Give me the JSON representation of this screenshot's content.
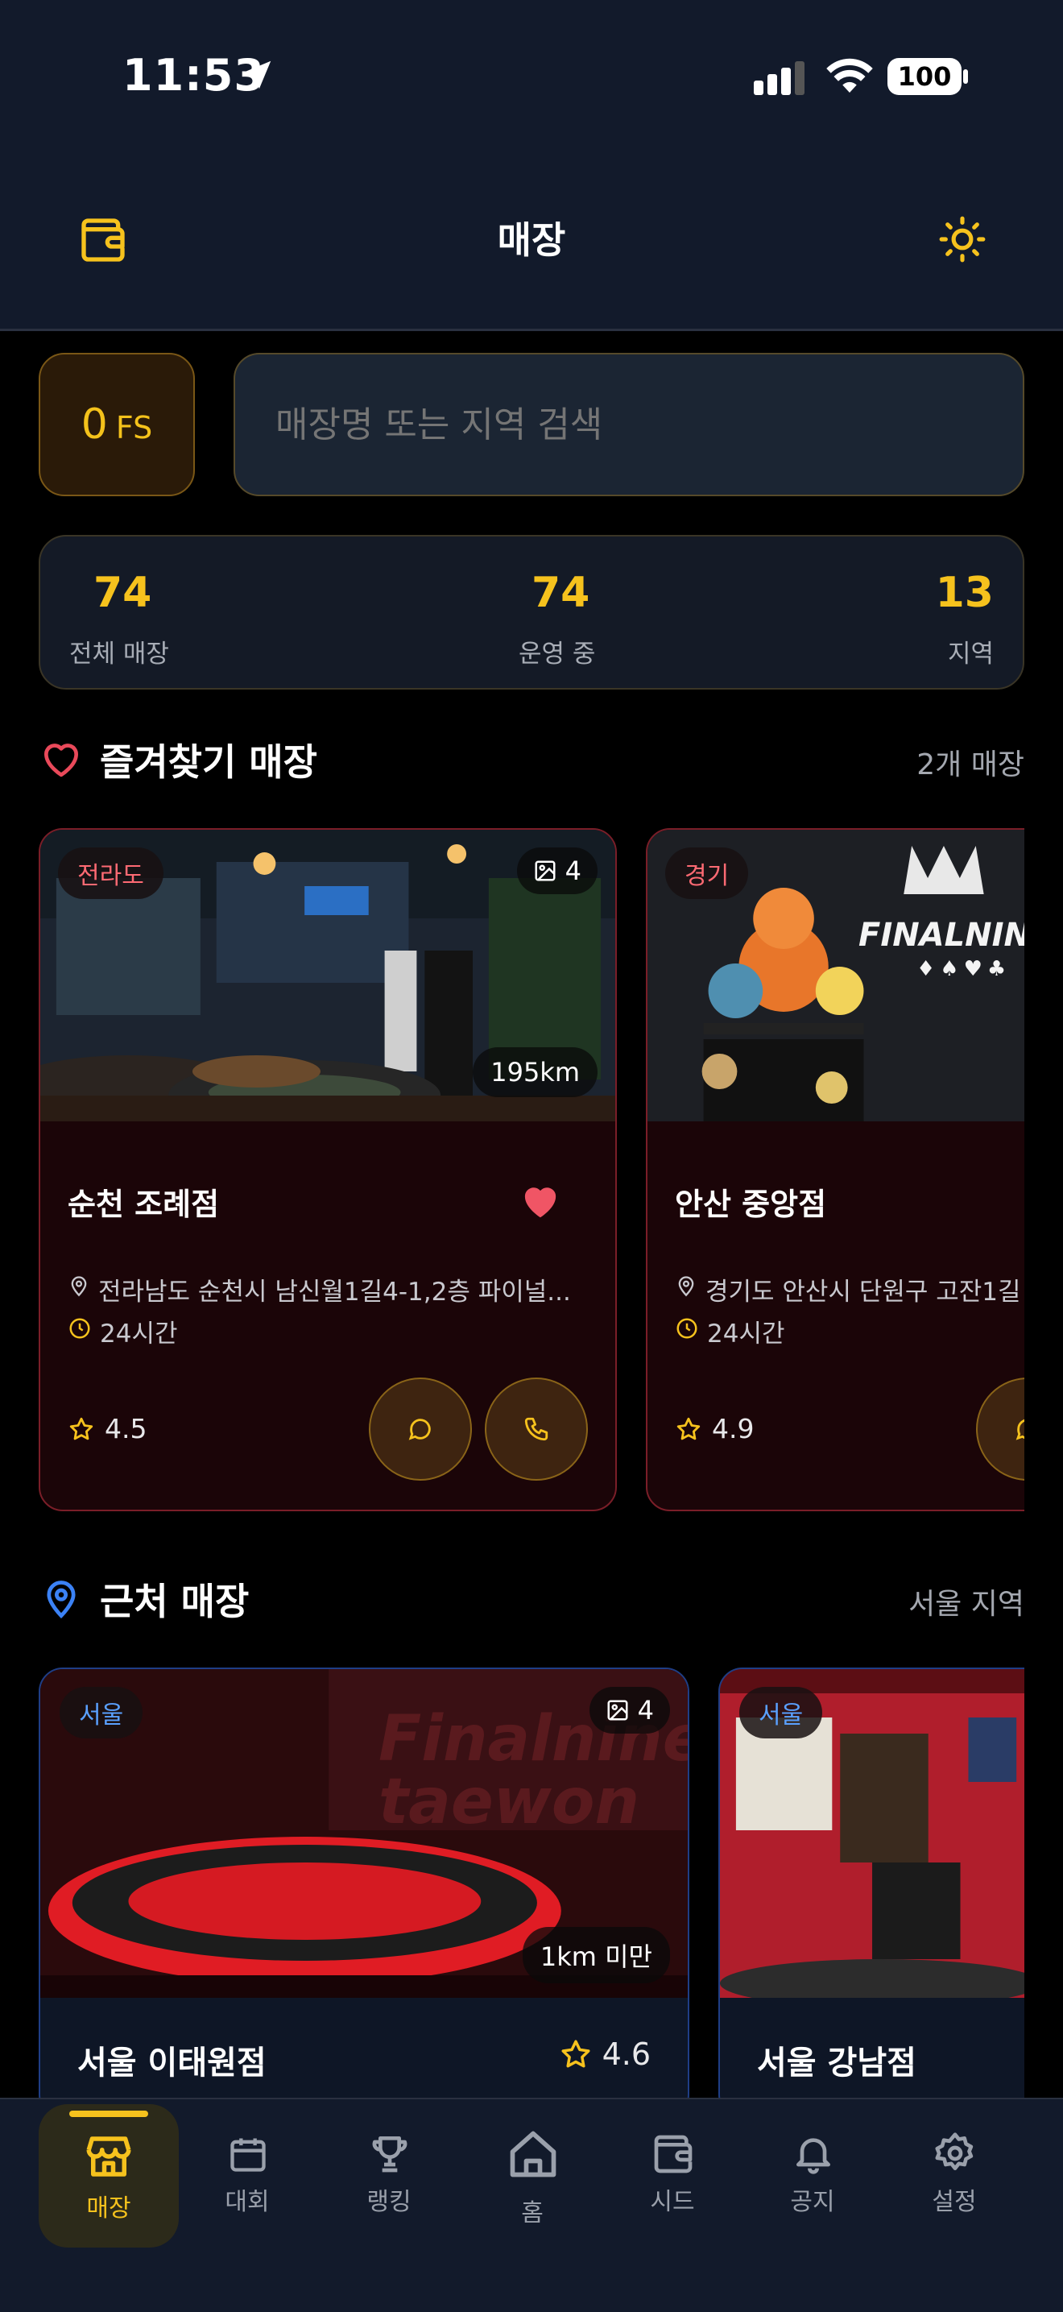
{
  "status_bar": {
    "time": "11:53",
    "battery": "100"
  },
  "header": {
    "title": "매장"
  },
  "balance": {
    "amount": "0",
    "unit": "FS"
  },
  "search": {
    "placeholder": "매장명 또는 지역 검색"
  },
  "stats": [
    {
      "value": "74",
      "label": "전체 매장"
    },
    {
      "value": "74",
      "label": "운영 중"
    },
    {
      "value": "13",
      "label": "지역"
    }
  ],
  "favorites": {
    "title": "즐겨찾기 매장",
    "count": "2개 매장",
    "stores": [
      {
        "region": "전라도",
        "photos": "4",
        "distance": "195km",
        "name": "순천 조례점",
        "address": "전라남도 순천시 남신월1길4-1,2층 파이널...",
        "hours": "24시간",
        "rating": "4.5",
        "favorited": true
      },
      {
        "region": "경기",
        "name": "안산 중앙점",
        "address": "경기도 안산시 단원구 고잔1길",
        "hours": "24시간",
        "rating": "4.9",
        "logo_text": "FINALNINE"
      }
    ]
  },
  "nearby": {
    "title": "근처 매장",
    "region": "서울 지역",
    "stores": [
      {
        "region": "서울",
        "photos": "4",
        "distance": "1km 미만",
        "name": "서울 이태원점",
        "rating": "4.6",
        "sign_text": "Finalnine taewon"
      },
      {
        "region": "서울",
        "name": "서울 강남점"
      }
    ]
  },
  "tabs": [
    {
      "label": "매장",
      "icon": "store-icon",
      "active": true
    },
    {
      "label": "대회",
      "icon": "calendar-icon"
    },
    {
      "label": "랭킹",
      "icon": "trophy-icon"
    },
    {
      "label": "홈",
      "icon": "home-icon"
    },
    {
      "label": "시드",
      "icon": "wallet-icon"
    },
    {
      "label": "공지",
      "icon": "bell-icon"
    },
    {
      "label": "설정",
      "icon": "gear-icon"
    }
  ],
  "colors": {
    "accent": "#f6c21d",
    "fav_red": "#e9495a",
    "near_blue": "#3b82f6",
    "bg": "#000000",
    "header_bg": "#121a2b"
  }
}
